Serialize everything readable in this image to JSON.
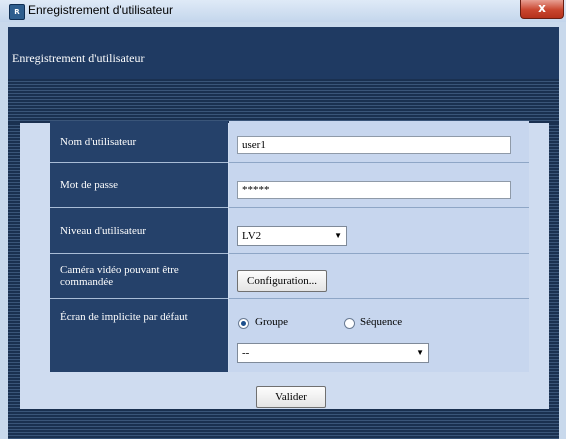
{
  "window": {
    "title": "Enregistrement d'utilisateur",
    "close_glyph": "x",
    "icon": "app-icon"
  },
  "header": {
    "title": "Enregistrement d'utilisateur"
  },
  "form": {
    "username": {
      "label": "Nom d'utilisateur",
      "value": "user1"
    },
    "password": {
      "label": "Mot de passe",
      "value": "*****"
    },
    "level": {
      "label": "Niveau d'utilisateur",
      "selected": "LV2"
    },
    "camera": {
      "label": "Caméra vidéo pouvant être commandée",
      "button": "Configuration..."
    },
    "default_screen": {
      "label": "Écran de implicite par défaut",
      "options": [
        {
          "label": "Groupe",
          "checked": true
        },
        {
          "label": "Séquence",
          "checked": false
        }
      ],
      "selected": "--"
    }
  },
  "actions": {
    "submit": "Valider"
  },
  "colors": {
    "panel": "#cfdcf0",
    "label_cell": "#25416a",
    "header": "#1f3a62",
    "close": "#c9462f"
  }
}
